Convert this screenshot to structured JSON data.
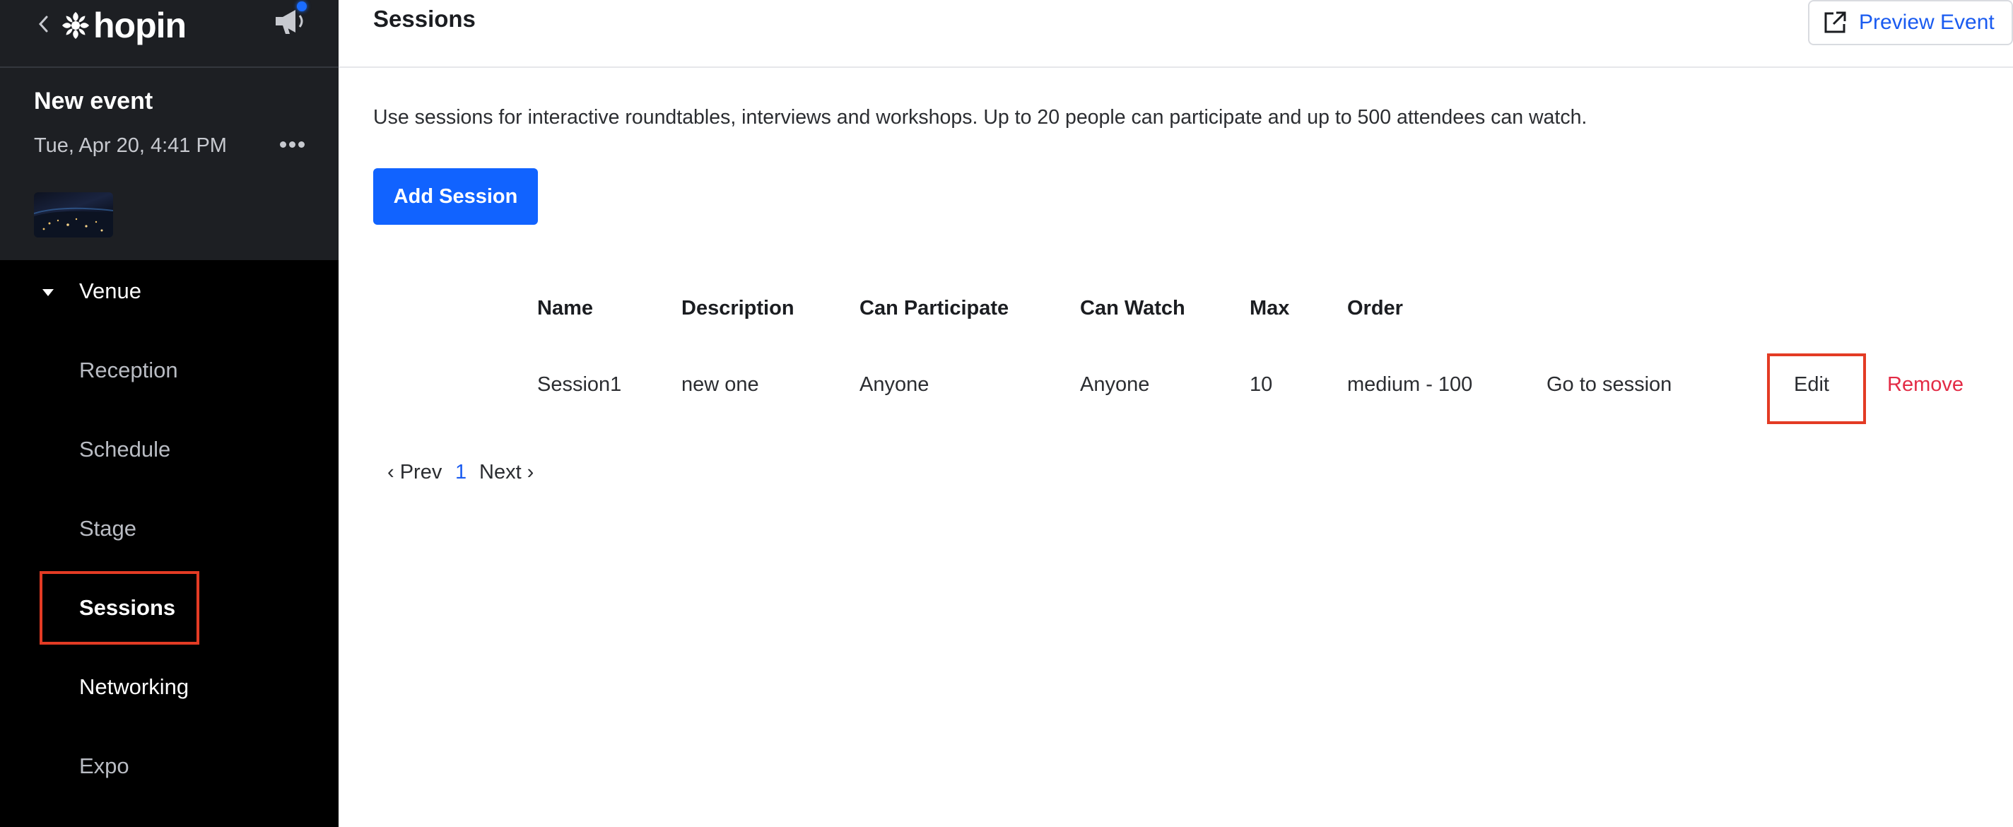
{
  "brand": {
    "name": "hopin"
  },
  "event": {
    "name": "New event",
    "date": "Tue, Apr 20, 4:41 PM"
  },
  "sidebar": {
    "section": "Venue",
    "items": [
      {
        "label": "Reception"
      },
      {
        "label": "Schedule"
      },
      {
        "label": "Stage"
      },
      {
        "label": "Sessions"
      },
      {
        "label": "Networking"
      },
      {
        "label": "Expo"
      }
    ]
  },
  "header": {
    "title": "Sessions",
    "preview_label": "Preview Event"
  },
  "main": {
    "intro": "Use sessions for interactive roundtables, interviews and workshops. Up to 20 people can participate and up to 500 attendees can watch.",
    "add_button": "Add Session",
    "table": {
      "columns": [
        "Name",
        "Description",
        "Can Participate",
        "Can Watch",
        "Max",
        "Order"
      ],
      "rows": [
        {
          "name": "Session1",
          "description": "new one",
          "can_participate": "Anyone",
          "can_watch": "Anyone",
          "max": "10",
          "order": "medium - 100",
          "go": "Go to session",
          "edit": "Edit",
          "remove": "Remove"
        }
      ]
    },
    "pagination": {
      "prev": "‹ Prev",
      "current": "1",
      "next": "Next ›"
    }
  },
  "colors": {
    "accent": "#1163ff",
    "danger": "#e32b45",
    "highlight": "#e33b24",
    "sidebar": "#000000"
  }
}
